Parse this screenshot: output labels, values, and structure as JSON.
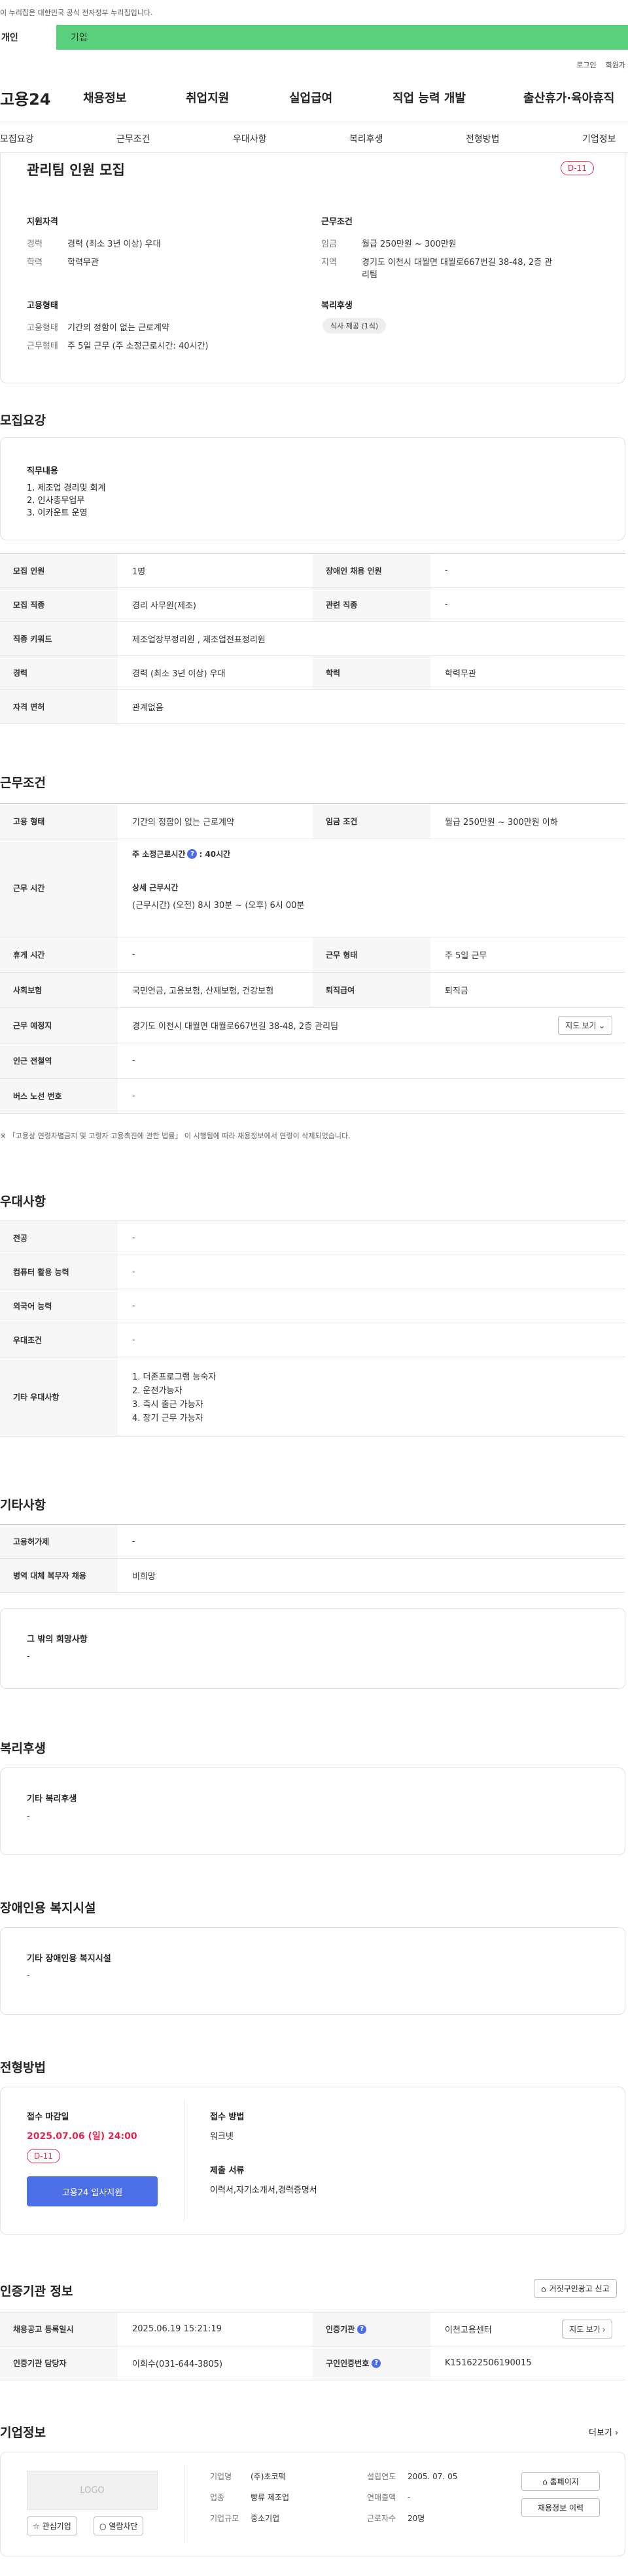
{
  "banner": {
    "text": "이 누리집은 대한민국 공식 전자정부 누리집입니다."
  },
  "top_tabs": {
    "personal": "개인",
    "company": "기업"
  },
  "util": {
    "login": "로그인",
    "join": "회원가"
  },
  "gnb": {
    "logo": "고용24",
    "menus": [
      "채용정보",
      "취업지원",
      "실업급여",
      "직업 능력 개발",
      "출산휴가·육아휴직"
    ]
  },
  "subnav": [
    "모집요강",
    "근무조건",
    "우대사항",
    "복리후생",
    "전형방법",
    "기업정보"
  ],
  "summary": {
    "title": "관리팀 인원 모집",
    "dday": "D-11",
    "qual_heading": "지원자격",
    "career_k": "경력",
    "career_v": "경력 (최소 3년 이상) 우대",
    "edu_k": "학력",
    "edu_v": "학력무관",
    "emp_heading": "고용형태",
    "emp_k": "고용형태",
    "emp_v": "기간의 정함이 없는 근로계약",
    "form_k": "근무형태",
    "form_v": "주 5일 근무 (주 소정근로시간: 40시간)",
    "cond_heading": "근무조건",
    "wage_k": "임금",
    "wage_v": "월급 250만원 ~ 300만원",
    "region_k": "지역",
    "region_v": "경기도 이천시 대월면 대월로667번길 38-48, 2층 관리팀",
    "welfare_heading": "복리후생",
    "welfare_chip": "식사 제공 (1식)"
  },
  "recruit": {
    "title": "모집요강",
    "duty_heading": "직무내용",
    "duties": [
      "1. 제조업 경리및 회계",
      "2. 인사총무업무",
      "3. 이카운트 운영"
    ],
    "rows": {
      "headcount_k": "모집 인원",
      "headcount_v": "1명",
      "disabled_k": "장애인 채용 인원",
      "disabled_v": "-",
      "job_k": "모집 직종",
      "job_v": "경리 사무원(제조)",
      "related_k": "관련 직종",
      "related_v": "-",
      "keyword_k": "직종 키워드",
      "keyword_v": "제조업장부정리원 , 제조업전표정리원",
      "career_k": "경력",
      "career_v": "경력 (최소 3년 이상) 우대",
      "edu_k": "학력",
      "edu_v": "학력무관",
      "license_k": "자격 면허",
      "license_v": "관계없음"
    }
  },
  "work": {
    "title": "근무조건",
    "type_k": "고용 형태",
    "type_v": "기간의 정함이 없는 근로계약",
    "wage_k": "임금 조건",
    "wage_v": "월급 250만원 ~ 300만원 이하",
    "hours_k": "근무 시간",
    "hours_main": "주 소정근로시간",
    "hours_value": ": 40시간",
    "hours_detail_title": "상세 근무시간",
    "hours_detail": "(근무시간) (오전) 8시 30분 ~ (오후) 6시 00분",
    "break_k": "휴게 시간",
    "break_v": "-",
    "form_k": "근무 형태",
    "form_v": "주 5일 근무",
    "insurance_k": "사회보험",
    "insurance_v": "국민연금, 고용보험, 산재보험, 건강보험",
    "retire_k": "퇴직급여",
    "retire_v": "퇴직금",
    "place_k": "근무 예정지",
    "place_v": "경기도 이천시 대월면 대월로667번길 38-48, 2층 관리팀",
    "map_btn": "지도 보기",
    "station_k": "인근 전철역",
    "station_v": "-",
    "bus_k": "버스 노선 번호",
    "bus_v": "-",
    "note": "「고용상 연령차별금지 및 고령자 고용촉진에 관한 법률」 이 시행됨에 따라 채용정보에서 연령이 삭제되었습니다."
  },
  "pref": {
    "title": "우대사항",
    "major_k": "전공",
    "major_v": "-",
    "pc_k": "컴퓨터 활용 능력",
    "pc_v": "-",
    "lang_k": "외국어 능력",
    "lang_v": "-",
    "cond_k": "우대조건",
    "cond_v": "-",
    "other_k": "기타 우대사항",
    "others": [
      "1. 더존프로그램 능숙자",
      "2. 운전가능자",
      "3. 즉시 출근 가능자",
      "4. 장기 근무 가능자"
    ]
  },
  "etc": {
    "title": "기타사항",
    "tax_k": "고용허가제",
    "tax_v": "-",
    "mil_k": "병역 대체 복무자 채용",
    "mil_v": "비희망",
    "hope_heading": "그 밖의 희망사항",
    "hope_v": "-"
  },
  "welfare": {
    "title": "복리후생",
    "heading": "기타 복리후생",
    "value": "-"
  },
  "facility": {
    "title": "장애인용 복지시설",
    "heading": "기타 장애인용 복지시설",
    "value": "-"
  },
  "process": {
    "title": "전형방법",
    "deadline_heading": "접수 마감일",
    "deadline": "2025.07.06 (일) 24:00",
    "dday": "D-11",
    "apply_btn": "고용24 입사지원",
    "method_heading": "접수 방법",
    "method_v": "워크넷",
    "docs_heading": "제출 서류",
    "docs_v": "이력서,자기소개서,경력증명서"
  },
  "agency": {
    "title": "인증기관 정보",
    "report_btn": "거짓구인광고 신고",
    "reg_k": "채용공고 등록일시",
    "reg_v": "2025.06.19 15:21:19",
    "agency_k": "인증기관",
    "agency_v": "이천고용센터",
    "map_btn": "지도 보기",
    "staff_k": "인증기관 담당자",
    "staff_v": "이희수(031-644-3805)",
    "num_k": "구인인증번호",
    "num_v": "K151622506190015"
  },
  "company": {
    "title": "기업정보",
    "more": "더보기",
    "logo_placeholder": "LOGO",
    "fav_btn": "관심기업",
    "block_btn": "열람차단",
    "name_k": "기업명",
    "name_v": "(주)초코팩",
    "industry_k": "업종",
    "industry_v": "빵류 제조업",
    "size_k": "기업규모",
    "size_v": "중소기업",
    "founded_k": "설립연도",
    "founded_v": "2005. 07. 05",
    "sales_k": "연매출액",
    "sales_v": "-",
    "employees_k": "근로자수",
    "employees_v": "20명",
    "home_btn": "홈페이지",
    "history_btn": "채용정보 이력"
  },
  "colors": {
    "accent": "#e3264f",
    "primary": "#4c6ee6",
    "green": "#5ad07e"
  }
}
